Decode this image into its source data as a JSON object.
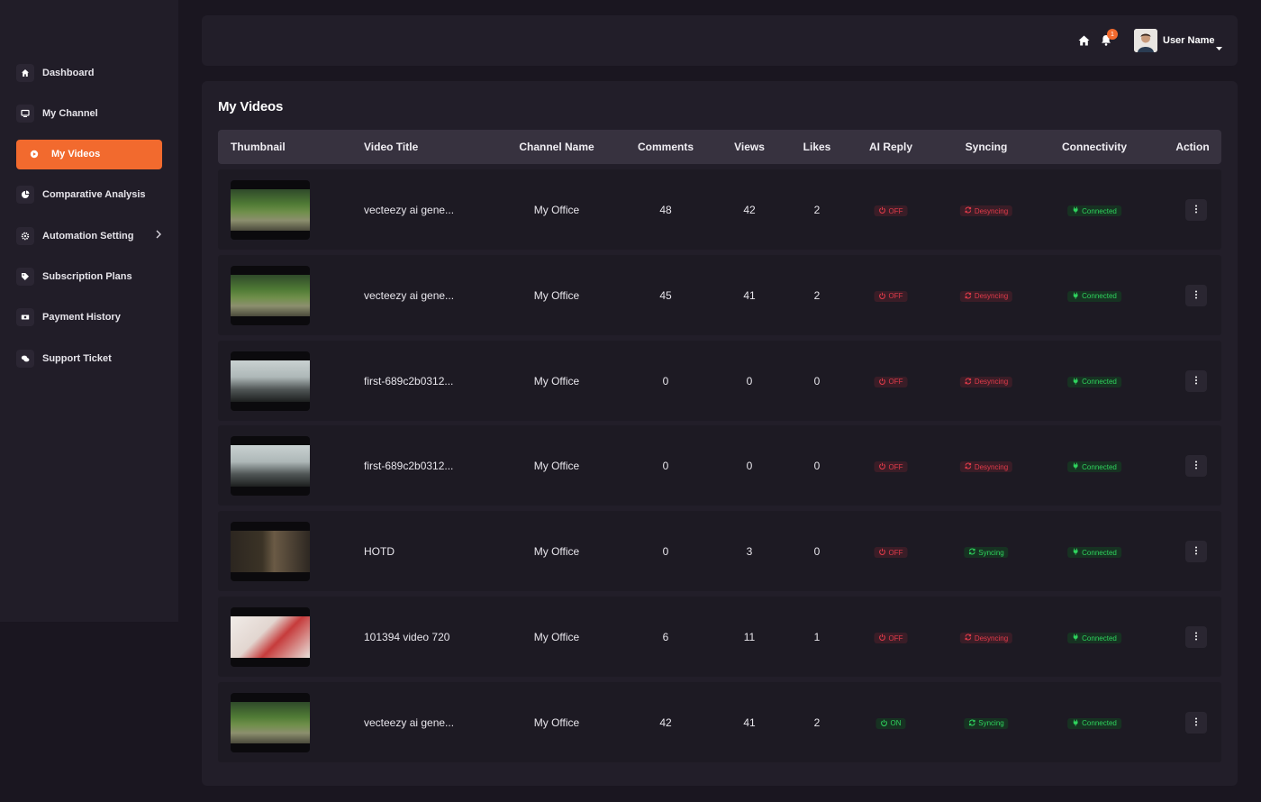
{
  "sidebar": {
    "items": [
      {
        "label": "Dashboard",
        "icon": "home-icon"
      },
      {
        "label": "My Channel",
        "icon": "monitor-icon"
      },
      {
        "label": "My Videos",
        "icon": "play-circle-icon",
        "active": true
      },
      {
        "label": "Comparative Analysis",
        "icon": "pie-chart-icon"
      },
      {
        "label": "Automation Setting",
        "icon": "gear-icon",
        "has_submenu": true
      },
      {
        "label": "Subscription Plans",
        "icon": "tag-icon"
      },
      {
        "label": "Payment History",
        "icon": "money-icon"
      },
      {
        "label": "Support Ticket",
        "icon": "chat-icon"
      }
    ]
  },
  "header": {
    "notification_count": "1",
    "user_name": "User Name"
  },
  "main": {
    "title": "My Videos",
    "columns": [
      "Thumbnail",
      "Video Title",
      "Channel Name",
      "Comments",
      "Views",
      "Likes",
      "AI Reply",
      "Syncing",
      "Connectivity",
      "Action"
    ],
    "rows": [
      {
        "thumb": "forest",
        "title": "vecteezy ai gene...",
        "channel": "My Office",
        "comments": "48",
        "views": "42",
        "likes": "2",
        "ai_reply": "OFF",
        "syncing": "Desyncing",
        "connectivity": "Connected"
      },
      {
        "thumb": "forest",
        "title": "vecteezy ai gene...",
        "channel": "My Office",
        "comments": "45",
        "views": "41",
        "likes": "2",
        "ai_reply": "OFF",
        "syncing": "Desyncing",
        "connectivity": "Connected"
      },
      {
        "thumb": "mist",
        "title": "first-689c2b0312...",
        "channel": "My Office",
        "comments": "0",
        "views": "0",
        "likes": "0",
        "ai_reply": "OFF",
        "syncing": "Desyncing",
        "connectivity": "Connected"
      },
      {
        "thumb": "mist",
        "title": "first-689c2b0312...",
        "channel": "My Office",
        "comments": "0",
        "views": "0",
        "likes": "0",
        "ai_reply": "OFF",
        "syncing": "Desyncing",
        "connectivity": "Connected"
      },
      {
        "thumb": "dark",
        "title": "HOTD",
        "channel": "My Office",
        "comments": "0",
        "views": "3",
        "likes": "0",
        "ai_reply": "OFF",
        "syncing": "Syncing",
        "connectivity": "Connected"
      },
      {
        "thumb": "desk",
        "title": "101394 video 720",
        "channel": "My Office",
        "comments": "6",
        "views": "11",
        "likes": "1",
        "ai_reply": "OFF",
        "syncing": "Desyncing",
        "connectivity": "Connected"
      },
      {
        "thumb": "forest",
        "title": "vecteezy ai gene...",
        "channel": "My Office",
        "comments": "42",
        "views": "41",
        "likes": "2",
        "ai_reply": "ON",
        "syncing": "Syncing",
        "connectivity": "Connected"
      }
    ]
  },
  "colors": {
    "accent": "#f26a2e",
    "danger": "#e23b4a",
    "success": "#2fd35d"
  }
}
